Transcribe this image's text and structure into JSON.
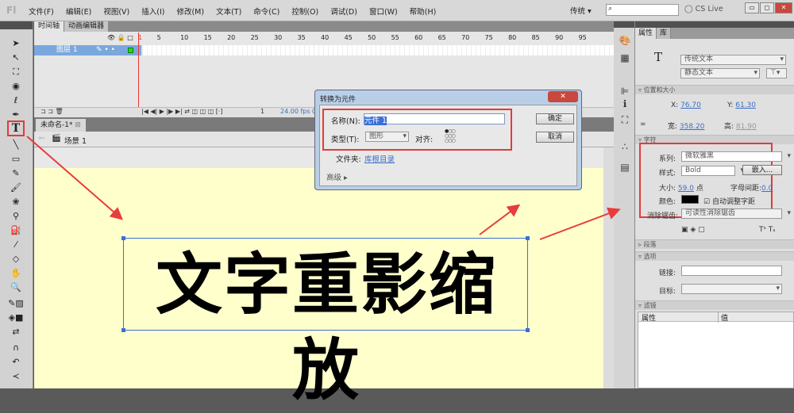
{
  "app": {
    "logo": "Fl",
    "menu": [
      "文件(F)",
      "编辑(E)",
      "视图(V)",
      "插入(I)",
      "修改(M)",
      "文本(T)",
      "命令(C)",
      "控制(O)",
      "调试(D)",
      "窗口(W)",
      "帮助(H)"
    ],
    "workspace": "传统 ▾",
    "cslive": "CS Live"
  },
  "timeline": {
    "tabs": [
      "时间轴",
      "动画编辑器"
    ],
    "ruler": [
      "1",
      "5",
      "10",
      "15",
      "20",
      "25",
      "30",
      "35",
      "40",
      "45",
      "50",
      "55",
      "60",
      "65",
      "70",
      "75",
      "80",
      "85",
      "90",
      "95"
    ],
    "layer_name": "图层 1",
    "current_frame": "1",
    "fps": "24.00 fps",
    "time": "0"
  },
  "document": {
    "tab": "未命名-1*",
    "scene": "场景 1",
    "stage_text": "文字重影缩放",
    "stage_color": "#ffffcc"
  },
  "dialog": {
    "title": "转换为元件",
    "name_label": "名称(N):",
    "name_value": "元件 1",
    "type_label": "类型(T):",
    "type_value": "图形",
    "align_label": "对齐:",
    "folder_label": "文件夹:",
    "folder_value": "库根目录",
    "advanced": "高级 ▸",
    "ok": "确定",
    "cancel": "取消"
  },
  "properties": {
    "tabs": [
      "属性",
      "库"
    ],
    "text_engine": "传统文本",
    "text_type": "静态文本",
    "pos_section": "位置和大小",
    "x_label": "X:",
    "x": "76.70",
    "y_label": "Y:",
    "y": "61.30",
    "w_label": "宽:",
    "w": "358.20",
    "h_label": "高:",
    "h": "81.90",
    "char_section": "字符",
    "family_label": "系列:",
    "family": "微软雅黑",
    "style_label": "样式:",
    "style": "Bold",
    "embed": "嵌入...",
    "size_label": "大小:",
    "size": "59.0",
    "size_unit": "点",
    "spacing_label": "字母间距:",
    "spacing": "0.0",
    "color_label": "颜色:",
    "text_color": "#000000",
    "autokern": "自动调整字距",
    "aa_label": "消除锯齿:",
    "aa": "可读性消除锯齿",
    "para_section": "段落",
    "options_section": "选项",
    "link_label": "链接:",
    "target_label": "目标:",
    "filter_section": "滤镜",
    "filter_col1": "属性",
    "filter_col2": "值"
  },
  "colors": {
    "highlight": "#e23b3b",
    "selection": "#3a6fd8"
  }
}
